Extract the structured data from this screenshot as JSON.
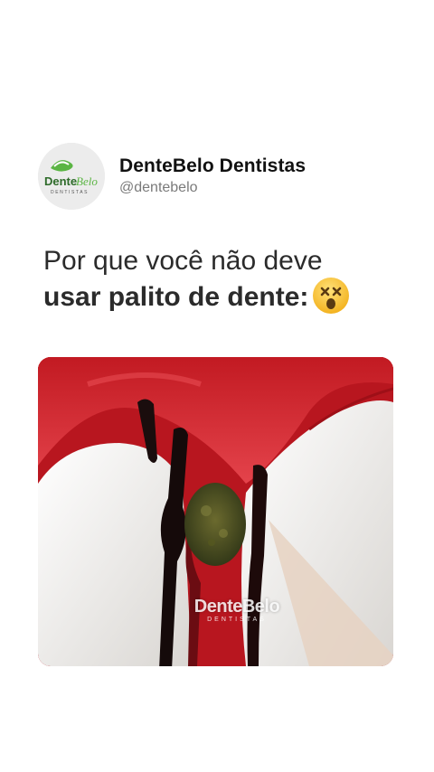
{
  "account": {
    "display_name": "DenteBelo Dentistas",
    "handle": "@dentebelo",
    "logo_text": "DenteBelo",
    "logo_subtext": "DENTISTAS"
  },
  "caption": {
    "line1": "Por que você não deve",
    "line2": "usar palito de dente:",
    "emoji": "dizzy-face-emoji"
  },
  "media": {
    "watermark_title": "DenteBelo",
    "watermark_sub": "DENTISTAS"
  },
  "colors": {
    "brand_green": "#4caf3a",
    "gum_red": "#c8202a",
    "emoji_yellow": "#f7c23a"
  }
}
